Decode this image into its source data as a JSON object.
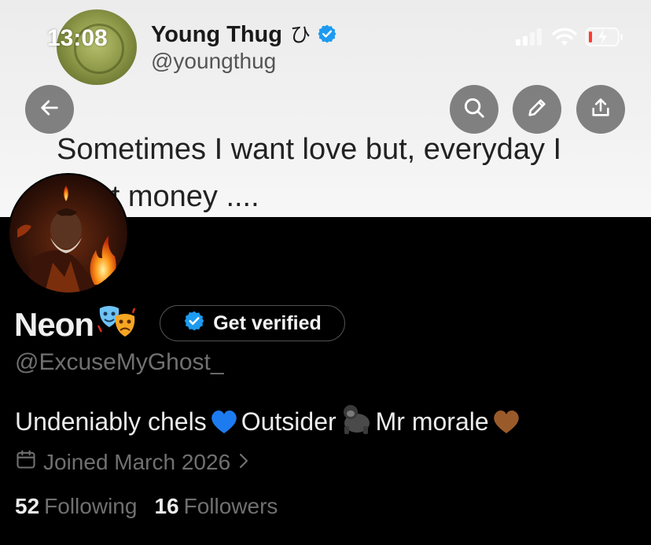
{
  "status_bar": {
    "time": "13:08"
  },
  "banner_tweet": {
    "name": "Young Thug",
    "name_glyph": "ひ",
    "handle": "@youngthug",
    "text": "Sometimes I want love but, everyday I want money ...."
  },
  "profile": {
    "name": "Neon",
    "get_verified_label": "Get verified",
    "handle": "@ExcuseMyGhost_",
    "bio": {
      "part1": "Undeniably chels",
      "part2": "Outsider",
      "part3": "Mr morale"
    },
    "joined": "Joined March 2026",
    "following_count": "52",
    "following_label": "Following",
    "followers_count": "16",
    "followers_label": "Followers"
  },
  "colors": {
    "background": "#000000",
    "verified_blue": "#1d9bf0",
    "muted_text": "#707070",
    "battery_low": "#ff3b30"
  },
  "icons": [
    "back-arrow-icon",
    "search-icon",
    "edit-pencil-icon",
    "share-icon",
    "calendar-icon",
    "chevron-right-icon",
    "verified-badge-icon"
  ]
}
